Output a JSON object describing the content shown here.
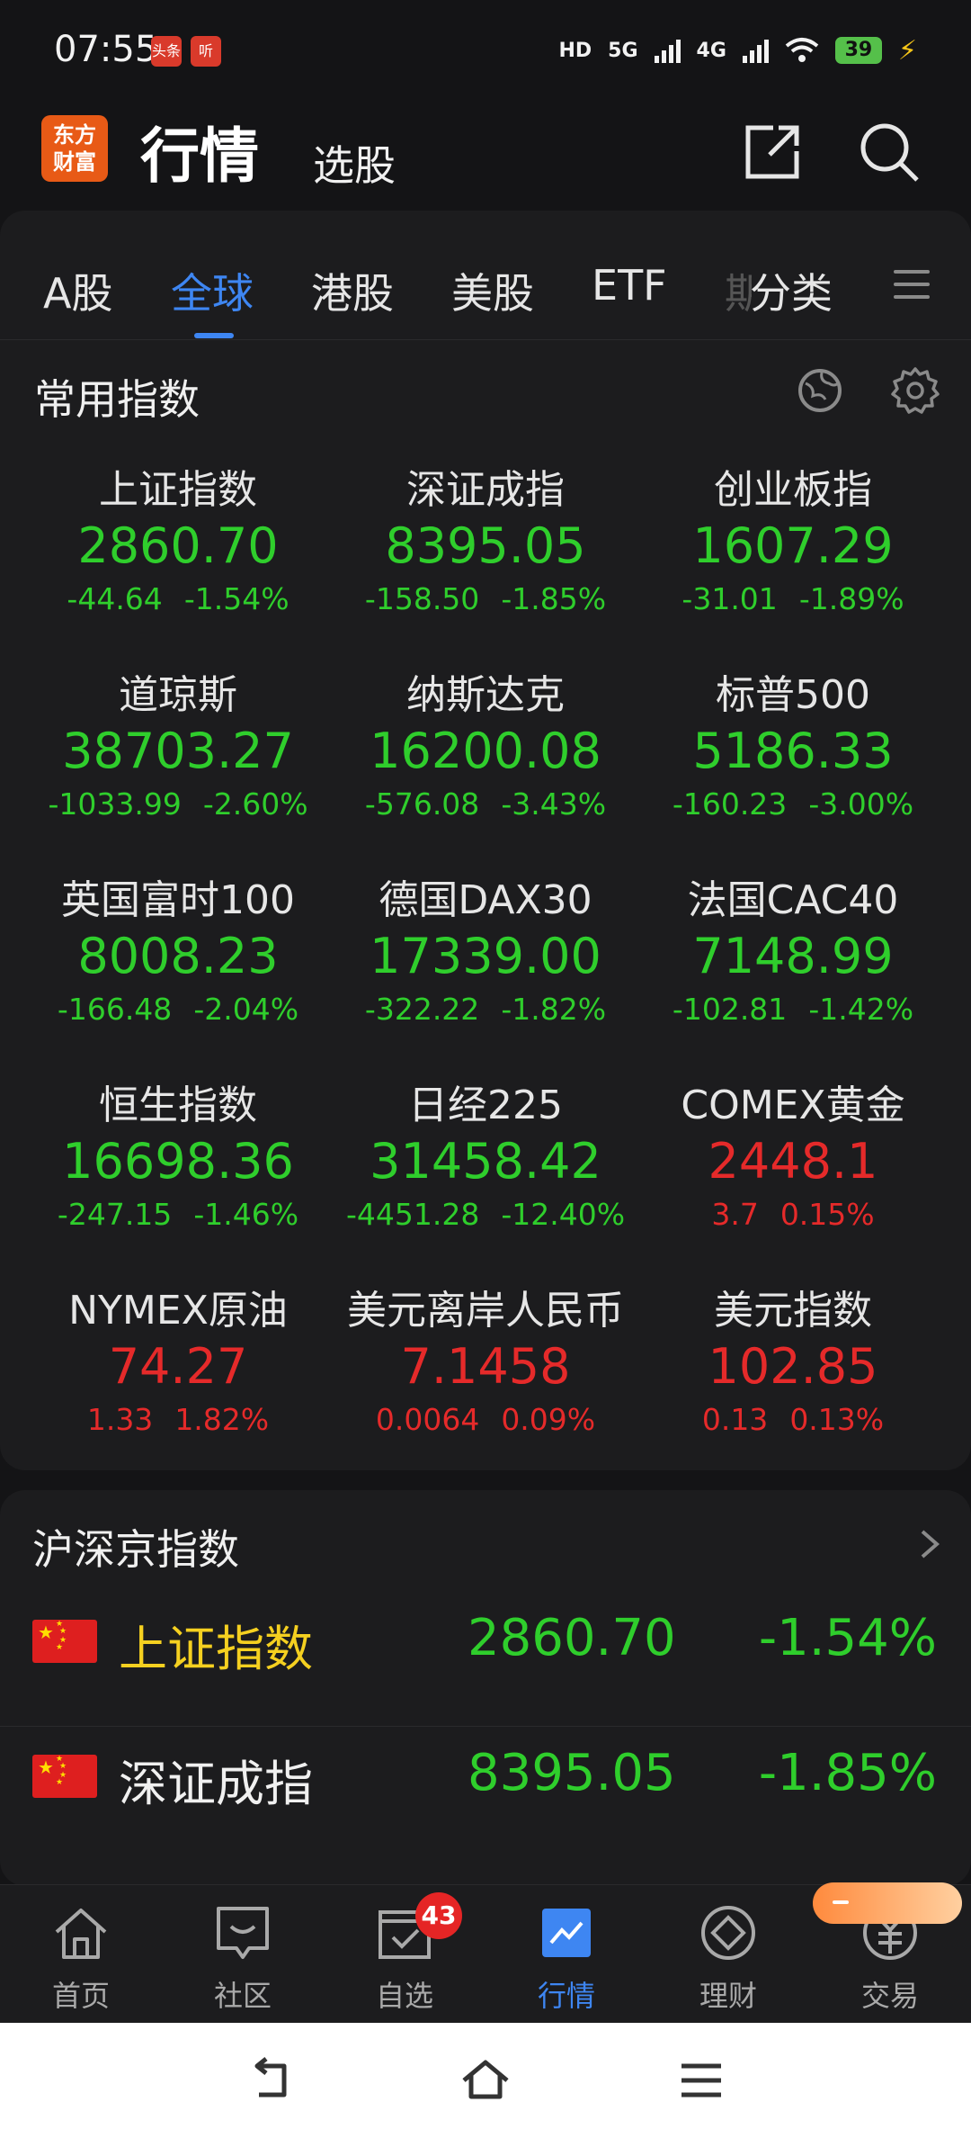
{
  "status_bar": {
    "time": "07:55",
    "app_icon_1": "头条",
    "app_icon_2": "听",
    "hd_label": "HD",
    "net_5g": "5G",
    "net_4g": "4G",
    "battery": "39"
  },
  "header": {
    "logo_line1": "东方",
    "logo_line2": "财富",
    "title": "行情",
    "subtitle": "选股"
  },
  "tabs": [
    {
      "label": "A股"
    },
    {
      "label": "全球"
    },
    {
      "label": "港股"
    },
    {
      "label": "美股"
    },
    {
      "label": "ETF"
    },
    {
      "label": "分类"
    }
  ],
  "tab_partial": "期",
  "common_indices": {
    "title": "常用指数",
    "items": [
      {
        "name": "上证指数",
        "price": "2860.70",
        "change": "-44.64",
        "pct": "-1.54%",
        "trend": "down"
      },
      {
        "name": "深证成指",
        "price": "8395.05",
        "change": "-158.50",
        "pct": "-1.85%",
        "trend": "down"
      },
      {
        "name": "创业板指",
        "price": "1607.29",
        "change": "-31.01",
        "pct": "-1.89%",
        "trend": "down"
      },
      {
        "name": "道琼斯",
        "price": "38703.27",
        "change": "-1033.99",
        "pct": "-2.60%",
        "trend": "down"
      },
      {
        "name": "纳斯达克",
        "price": "16200.08",
        "change": "-576.08",
        "pct": "-3.43%",
        "trend": "down"
      },
      {
        "name": "标普500",
        "price": "5186.33",
        "change": "-160.23",
        "pct": "-3.00%",
        "trend": "down"
      },
      {
        "name": "英国富时100",
        "price": "8008.23",
        "change": "-166.48",
        "pct": "-2.04%",
        "trend": "down"
      },
      {
        "name": "德国DAX30",
        "price": "17339.00",
        "change": "-322.22",
        "pct": "-1.82%",
        "trend": "down"
      },
      {
        "name": "法国CAC40",
        "price": "7148.99",
        "change": "-102.81",
        "pct": "-1.42%",
        "trend": "down"
      },
      {
        "name": "恒生指数",
        "price": "16698.36",
        "change": "-247.15",
        "pct": "-1.46%",
        "trend": "down"
      },
      {
        "name": "日经225",
        "price": "31458.42",
        "change": "-4451.28",
        "pct": "-12.40%",
        "trend": "down"
      },
      {
        "name": "COMEX黄金",
        "price": "2448.1",
        "change": "3.7",
        "pct": "0.15%",
        "trend": "up"
      },
      {
        "name": "NYMEX原油",
        "price": "74.27",
        "change": "1.33",
        "pct": "1.82%",
        "trend": "up"
      },
      {
        "name": "美元离岸人民币",
        "price": "7.1458",
        "change": "0.0064",
        "pct": "0.09%",
        "trend": "up"
      },
      {
        "name": "美元指数",
        "price": "102.85",
        "change": "0.13",
        "pct": "0.13%",
        "trend": "up"
      }
    ]
  },
  "hsj_indices": {
    "title": "沪深京指数",
    "rows": [
      {
        "name": "上证指数",
        "price": "2860.70",
        "pct": "-1.54%"
      },
      {
        "name": "深证成指",
        "price": "8395.05",
        "pct": "-1.85%"
      }
    ]
  },
  "bottom_nav": [
    {
      "label": "首页",
      "icon": "home-icon"
    },
    {
      "label": "社区",
      "icon": "community-icon"
    },
    {
      "label": "自选",
      "icon": "watchlist-icon",
      "badge": "43"
    },
    {
      "label": "行情",
      "icon": "market-icon"
    },
    {
      "label": "理财",
      "icon": "wealth-icon"
    },
    {
      "label": "交易",
      "icon": "trade-icon"
    }
  ],
  "colors": {
    "up": "#e52a2a",
    "down": "#2fce2c",
    "accent": "#3e86f2",
    "highlight_name": "#f5d020"
  }
}
